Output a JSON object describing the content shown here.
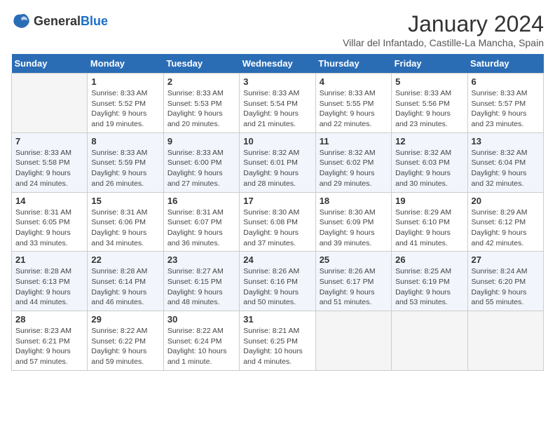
{
  "header": {
    "logo_general": "General",
    "logo_blue": "Blue",
    "title": "January 2024",
    "subtitle": "Villar del Infantado, Castille-La Mancha, Spain"
  },
  "days_of_week": [
    "Sunday",
    "Monday",
    "Tuesday",
    "Wednesday",
    "Thursday",
    "Friday",
    "Saturday"
  ],
  "weeks": [
    [
      {
        "day": "",
        "sunrise": "",
        "sunset": "",
        "daylight": ""
      },
      {
        "day": "1",
        "sunrise": "Sunrise: 8:33 AM",
        "sunset": "Sunset: 5:52 PM",
        "daylight": "Daylight: 9 hours and 19 minutes."
      },
      {
        "day": "2",
        "sunrise": "Sunrise: 8:33 AM",
        "sunset": "Sunset: 5:53 PM",
        "daylight": "Daylight: 9 hours and 20 minutes."
      },
      {
        "day": "3",
        "sunrise": "Sunrise: 8:33 AM",
        "sunset": "Sunset: 5:54 PM",
        "daylight": "Daylight: 9 hours and 21 minutes."
      },
      {
        "day": "4",
        "sunrise": "Sunrise: 8:33 AM",
        "sunset": "Sunset: 5:55 PM",
        "daylight": "Daylight: 9 hours and 22 minutes."
      },
      {
        "day": "5",
        "sunrise": "Sunrise: 8:33 AM",
        "sunset": "Sunset: 5:56 PM",
        "daylight": "Daylight: 9 hours and 23 minutes."
      },
      {
        "day": "6",
        "sunrise": "Sunrise: 8:33 AM",
        "sunset": "Sunset: 5:57 PM",
        "daylight": "Daylight: 9 hours and 23 minutes."
      }
    ],
    [
      {
        "day": "7",
        "sunrise": "Sunrise: 8:33 AM",
        "sunset": "Sunset: 5:58 PM",
        "daylight": "Daylight: 9 hours and 24 minutes."
      },
      {
        "day": "8",
        "sunrise": "Sunrise: 8:33 AM",
        "sunset": "Sunset: 5:59 PM",
        "daylight": "Daylight: 9 hours and 26 minutes."
      },
      {
        "day": "9",
        "sunrise": "Sunrise: 8:33 AM",
        "sunset": "Sunset: 6:00 PM",
        "daylight": "Daylight: 9 hours and 27 minutes."
      },
      {
        "day": "10",
        "sunrise": "Sunrise: 8:32 AM",
        "sunset": "Sunset: 6:01 PM",
        "daylight": "Daylight: 9 hours and 28 minutes."
      },
      {
        "day": "11",
        "sunrise": "Sunrise: 8:32 AM",
        "sunset": "Sunset: 6:02 PM",
        "daylight": "Daylight: 9 hours and 29 minutes."
      },
      {
        "day": "12",
        "sunrise": "Sunrise: 8:32 AM",
        "sunset": "Sunset: 6:03 PM",
        "daylight": "Daylight: 9 hours and 30 minutes."
      },
      {
        "day": "13",
        "sunrise": "Sunrise: 8:32 AM",
        "sunset": "Sunset: 6:04 PM",
        "daylight": "Daylight: 9 hours and 32 minutes."
      }
    ],
    [
      {
        "day": "14",
        "sunrise": "Sunrise: 8:31 AM",
        "sunset": "Sunset: 6:05 PM",
        "daylight": "Daylight: 9 hours and 33 minutes."
      },
      {
        "day": "15",
        "sunrise": "Sunrise: 8:31 AM",
        "sunset": "Sunset: 6:06 PM",
        "daylight": "Daylight: 9 hours and 34 minutes."
      },
      {
        "day": "16",
        "sunrise": "Sunrise: 8:31 AM",
        "sunset": "Sunset: 6:07 PM",
        "daylight": "Daylight: 9 hours and 36 minutes."
      },
      {
        "day": "17",
        "sunrise": "Sunrise: 8:30 AM",
        "sunset": "Sunset: 6:08 PM",
        "daylight": "Daylight: 9 hours and 37 minutes."
      },
      {
        "day": "18",
        "sunrise": "Sunrise: 8:30 AM",
        "sunset": "Sunset: 6:09 PM",
        "daylight": "Daylight: 9 hours and 39 minutes."
      },
      {
        "day": "19",
        "sunrise": "Sunrise: 8:29 AM",
        "sunset": "Sunset: 6:10 PM",
        "daylight": "Daylight: 9 hours and 41 minutes."
      },
      {
        "day": "20",
        "sunrise": "Sunrise: 8:29 AM",
        "sunset": "Sunset: 6:12 PM",
        "daylight": "Daylight: 9 hours and 42 minutes."
      }
    ],
    [
      {
        "day": "21",
        "sunrise": "Sunrise: 8:28 AM",
        "sunset": "Sunset: 6:13 PM",
        "daylight": "Daylight: 9 hours and 44 minutes."
      },
      {
        "day": "22",
        "sunrise": "Sunrise: 8:28 AM",
        "sunset": "Sunset: 6:14 PM",
        "daylight": "Daylight: 9 hours and 46 minutes."
      },
      {
        "day": "23",
        "sunrise": "Sunrise: 8:27 AM",
        "sunset": "Sunset: 6:15 PM",
        "daylight": "Daylight: 9 hours and 48 minutes."
      },
      {
        "day": "24",
        "sunrise": "Sunrise: 8:26 AM",
        "sunset": "Sunset: 6:16 PM",
        "daylight": "Daylight: 9 hours and 50 minutes."
      },
      {
        "day": "25",
        "sunrise": "Sunrise: 8:26 AM",
        "sunset": "Sunset: 6:17 PM",
        "daylight": "Daylight: 9 hours and 51 minutes."
      },
      {
        "day": "26",
        "sunrise": "Sunrise: 8:25 AM",
        "sunset": "Sunset: 6:19 PM",
        "daylight": "Daylight: 9 hours and 53 minutes."
      },
      {
        "day": "27",
        "sunrise": "Sunrise: 8:24 AM",
        "sunset": "Sunset: 6:20 PM",
        "daylight": "Daylight: 9 hours and 55 minutes."
      }
    ],
    [
      {
        "day": "28",
        "sunrise": "Sunrise: 8:23 AM",
        "sunset": "Sunset: 6:21 PM",
        "daylight": "Daylight: 9 hours and 57 minutes."
      },
      {
        "day": "29",
        "sunrise": "Sunrise: 8:22 AM",
        "sunset": "Sunset: 6:22 PM",
        "daylight": "Daylight: 9 hours and 59 minutes."
      },
      {
        "day": "30",
        "sunrise": "Sunrise: 8:22 AM",
        "sunset": "Sunset: 6:24 PM",
        "daylight": "Daylight: 10 hours and 1 minute."
      },
      {
        "day": "31",
        "sunrise": "Sunrise: 8:21 AM",
        "sunset": "Sunset: 6:25 PM",
        "daylight": "Daylight: 10 hours and 4 minutes."
      },
      {
        "day": "",
        "sunrise": "",
        "sunset": "",
        "daylight": ""
      },
      {
        "day": "",
        "sunrise": "",
        "sunset": "",
        "daylight": ""
      },
      {
        "day": "",
        "sunrise": "",
        "sunset": "",
        "daylight": ""
      }
    ]
  ]
}
